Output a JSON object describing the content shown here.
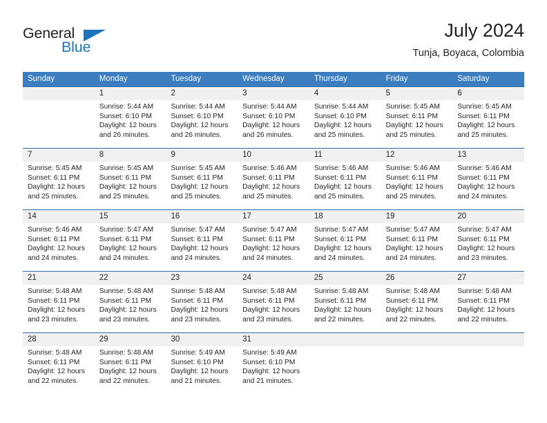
{
  "brand": {
    "name_part1": "General",
    "name_part2": "Blue"
  },
  "header": {
    "title": "July 2024",
    "subtitle": "Tunja, Boyaca, Colombia"
  },
  "colors": {
    "header_blue": "#3b7dbf",
    "row_divider_blue": "#2f6ca8",
    "daynum_band": "#f0f0f0",
    "brand_blue": "#1b75bb",
    "text": "#231f20"
  },
  "weekdays": [
    "Sunday",
    "Monday",
    "Tuesday",
    "Wednesday",
    "Thursday",
    "Friday",
    "Saturday"
  ],
  "weeks": [
    [
      {
        "day": "",
        "sunrise": "",
        "sunset": "",
        "daylight1": "",
        "daylight2": ""
      },
      {
        "day": "1",
        "sunrise": "Sunrise: 5:44 AM",
        "sunset": "Sunset: 6:10 PM",
        "daylight1": "Daylight: 12 hours",
        "daylight2": "and 26 minutes."
      },
      {
        "day": "2",
        "sunrise": "Sunrise: 5:44 AM",
        "sunset": "Sunset: 6:10 PM",
        "daylight1": "Daylight: 12 hours",
        "daylight2": "and 26 minutes."
      },
      {
        "day": "3",
        "sunrise": "Sunrise: 5:44 AM",
        "sunset": "Sunset: 6:10 PM",
        "daylight1": "Daylight: 12 hours",
        "daylight2": "and 26 minutes."
      },
      {
        "day": "4",
        "sunrise": "Sunrise: 5:44 AM",
        "sunset": "Sunset: 6:10 PM",
        "daylight1": "Daylight: 12 hours",
        "daylight2": "and 25 minutes."
      },
      {
        "day": "5",
        "sunrise": "Sunrise: 5:45 AM",
        "sunset": "Sunset: 6:11 PM",
        "daylight1": "Daylight: 12 hours",
        "daylight2": "and 25 minutes."
      },
      {
        "day": "6",
        "sunrise": "Sunrise: 5:45 AM",
        "sunset": "Sunset: 6:11 PM",
        "daylight1": "Daylight: 12 hours",
        "daylight2": "and 25 minutes."
      }
    ],
    [
      {
        "day": "7",
        "sunrise": "Sunrise: 5:45 AM",
        "sunset": "Sunset: 6:11 PM",
        "daylight1": "Daylight: 12 hours",
        "daylight2": "and 25 minutes."
      },
      {
        "day": "8",
        "sunrise": "Sunrise: 5:45 AM",
        "sunset": "Sunset: 6:11 PM",
        "daylight1": "Daylight: 12 hours",
        "daylight2": "and 25 minutes."
      },
      {
        "day": "9",
        "sunrise": "Sunrise: 5:45 AM",
        "sunset": "Sunset: 6:11 PM",
        "daylight1": "Daylight: 12 hours",
        "daylight2": "and 25 minutes."
      },
      {
        "day": "10",
        "sunrise": "Sunrise: 5:46 AM",
        "sunset": "Sunset: 6:11 PM",
        "daylight1": "Daylight: 12 hours",
        "daylight2": "and 25 minutes."
      },
      {
        "day": "11",
        "sunrise": "Sunrise: 5:46 AM",
        "sunset": "Sunset: 6:11 PM",
        "daylight1": "Daylight: 12 hours",
        "daylight2": "and 25 minutes."
      },
      {
        "day": "12",
        "sunrise": "Sunrise: 5:46 AM",
        "sunset": "Sunset: 6:11 PM",
        "daylight1": "Daylight: 12 hours",
        "daylight2": "and 25 minutes."
      },
      {
        "day": "13",
        "sunrise": "Sunrise: 5:46 AM",
        "sunset": "Sunset: 6:11 PM",
        "daylight1": "Daylight: 12 hours",
        "daylight2": "and 24 minutes."
      }
    ],
    [
      {
        "day": "14",
        "sunrise": "Sunrise: 5:46 AM",
        "sunset": "Sunset: 6:11 PM",
        "daylight1": "Daylight: 12 hours",
        "daylight2": "and 24 minutes."
      },
      {
        "day": "15",
        "sunrise": "Sunrise: 5:47 AM",
        "sunset": "Sunset: 6:11 PM",
        "daylight1": "Daylight: 12 hours",
        "daylight2": "and 24 minutes."
      },
      {
        "day": "16",
        "sunrise": "Sunrise: 5:47 AM",
        "sunset": "Sunset: 6:11 PM",
        "daylight1": "Daylight: 12 hours",
        "daylight2": "and 24 minutes."
      },
      {
        "day": "17",
        "sunrise": "Sunrise: 5:47 AM",
        "sunset": "Sunset: 6:11 PM",
        "daylight1": "Daylight: 12 hours",
        "daylight2": "and 24 minutes."
      },
      {
        "day": "18",
        "sunrise": "Sunrise: 5:47 AM",
        "sunset": "Sunset: 6:11 PM",
        "daylight1": "Daylight: 12 hours",
        "daylight2": "and 24 minutes."
      },
      {
        "day": "19",
        "sunrise": "Sunrise: 5:47 AM",
        "sunset": "Sunset: 6:11 PM",
        "daylight1": "Daylight: 12 hours",
        "daylight2": "and 24 minutes."
      },
      {
        "day": "20",
        "sunrise": "Sunrise: 5:47 AM",
        "sunset": "Sunset: 6:11 PM",
        "daylight1": "Daylight: 12 hours",
        "daylight2": "and 23 minutes."
      }
    ],
    [
      {
        "day": "21",
        "sunrise": "Sunrise: 5:48 AM",
        "sunset": "Sunset: 6:11 PM",
        "daylight1": "Daylight: 12 hours",
        "daylight2": "and 23 minutes."
      },
      {
        "day": "22",
        "sunrise": "Sunrise: 5:48 AM",
        "sunset": "Sunset: 6:11 PM",
        "daylight1": "Daylight: 12 hours",
        "daylight2": "and 23 minutes."
      },
      {
        "day": "23",
        "sunrise": "Sunrise: 5:48 AM",
        "sunset": "Sunset: 6:11 PM",
        "daylight1": "Daylight: 12 hours",
        "daylight2": "and 23 minutes."
      },
      {
        "day": "24",
        "sunrise": "Sunrise: 5:48 AM",
        "sunset": "Sunset: 6:11 PM",
        "daylight1": "Daylight: 12 hours",
        "daylight2": "and 23 minutes."
      },
      {
        "day": "25",
        "sunrise": "Sunrise: 5:48 AM",
        "sunset": "Sunset: 6:11 PM",
        "daylight1": "Daylight: 12 hours",
        "daylight2": "and 22 minutes."
      },
      {
        "day": "26",
        "sunrise": "Sunrise: 5:48 AM",
        "sunset": "Sunset: 6:11 PM",
        "daylight1": "Daylight: 12 hours",
        "daylight2": "and 22 minutes."
      },
      {
        "day": "27",
        "sunrise": "Sunrise: 5:48 AM",
        "sunset": "Sunset: 6:11 PM",
        "daylight1": "Daylight: 12 hours",
        "daylight2": "and 22 minutes."
      }
    ],
    [
      {
        "day": "28",
        "sunrise": "Sunrise: 5:48 AM",
        "sunset": "Sunset: 6:11 PM",
        "daylight1": "Daylight: 12 hours",
        "daylight2": "and 22 minutes."
      },
      {
        "day": "29",
        "sunrise": "Sunrise: 5:48 AM",
        "sunset": "Sunset: 6:11 PM",
        "daylight1": "Daylight: 12 hours",
        "daylight2": "and 22 minutes."
      },
      {
        "day": "30",
        "sunrise": "Sunrise: 5:49 AM",
        "sunset": "Sunset: 6:10 PM",
        "daylight1": "Daylight: 12 hours",
        "daylight2": "and 21 minutes."
      },
      {
        "day": "31",
        "sunrise": "Sunrise: 5:49 AM",
        "sunset": "Sunset: 6:10 PM",
        "daylight1": "Daylight: 12 hours",
        "daylight2": "and 21 minutes."
      },
      {
        "day": "",
        "sunrise": "",
        "sunset": "",
        "daylight1": "",
        "daylight2": ""
      },
      {
        "day": "",
        "sunrise": "",
        "sunset": "",
        "daylight1": "",
        "daylight2": ""
      },
      {
        "day": "",
        "sunrise": "",
        "sunset": "",
        "daylight1": "",
        "daylight2": ""
      }
    ]
  ]
}
